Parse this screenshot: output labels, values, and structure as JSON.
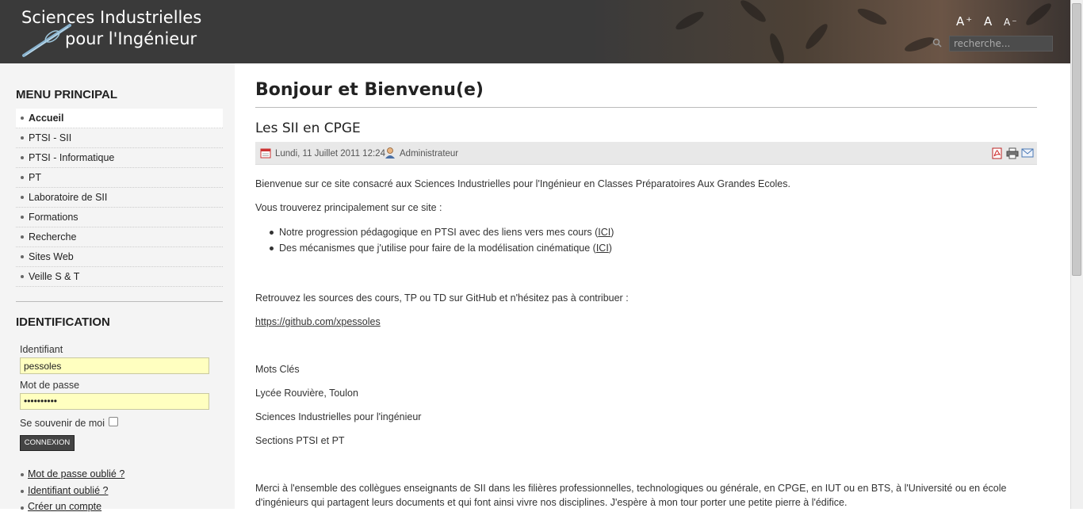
{
  "header": {
    "logo_line1": "Sciences Industrielles",
    "logo_line2": "pour l'Ingénieur",
    "font_larger": "A⁺",
    "font_reset": "A",
    "font_smaller": "A⁻",
    "search_placeholder": "recherche..."
  },
  "sidebar": {
    "menu_title": "MENU PRINCIPAL",
    "menu_items": [
      {
        "label": "Accueil",
        "active": true
      },
      {
        "label": "PTSI - SII"
      },
      {
        "label": "PTSI - Informatique"
      },
      {
        "label": "PT"
      },
      {
        "label": "Laboratoire de SII"
      },
      {
        "label": "Formations"
      },
      {
        "label": "Recherche"
      },
      {
        "label": "Sites Web"
      },
      {
        "label": "Veille S & T"
      }
    ],
    "login": {
      "title": "IDENTIFICATION",
      "username_label": "Identifiant",
      "username_value": "pessoles",
      "password_label": "Mot de passe",
      "password_value": "••••••••••",
      "remember_label": "Se souvenir de moi",
      "button_label": "CONNEXION",
      "links": [
        "Mot de passe oublié ?",
        "Identifiant oublié ?",
        "Créer un compte"
      ]
    }
  },
  "main": {
    "page_title": "Bonjour et Bienvenu(e)",
    "article_title": "Les SII en CPGE",
    "meta_date": "Lundi, 11 Juillet 2011 12:24",
    "meta_author": "Administrateur",
    "intro": "Bienvenue sur ce site consacré aux Sciences Industrielles pour l'Ingénieur en Classes Préparatoires Aux Grandes Ecoles.",
    "lead": "Vous trouverez principalement sur ce site :",
    "bullets": [
      {
        "text": "Notre progression pédagogique en PTSI avec des liens vers mes cours (",
        "link": "ICI",
        "tail": ")"
      },
      {
        "text": "Des mécanismes que j'utilise pour faire de la modélisation cinématique (",
        "link": "ICI",
        "tail": ")"
      }
    ],
    "github_text": "Retrouvez les sources des cours, TP ou TD sur GitHub et n'hésitez pas à contribuer :",
    "github_link": "https://github.com/xpessoles",
    "keywords_title": "Mots Clés",
    "keywords": [
      "Lycée Rouvière, Toulon",
      "Sciences Industrielles pour l'ingénieur",
      "Sections PTSI et PT"
    ],
    "thanks_line1": "Merci à l'ensemble des collègues enseignants de SII dans les filières professionnelles, technologiques ou générale, en CPGE, en IUT ou en BTS, à l'Université ou en école",
    "thanks_line2": "d'ingénieurs qui partagent leurs documents et qui font ainsi vivre nos disciplines. J'espère à mon tour porter une petite pierre à l'édifice."
  }
}
